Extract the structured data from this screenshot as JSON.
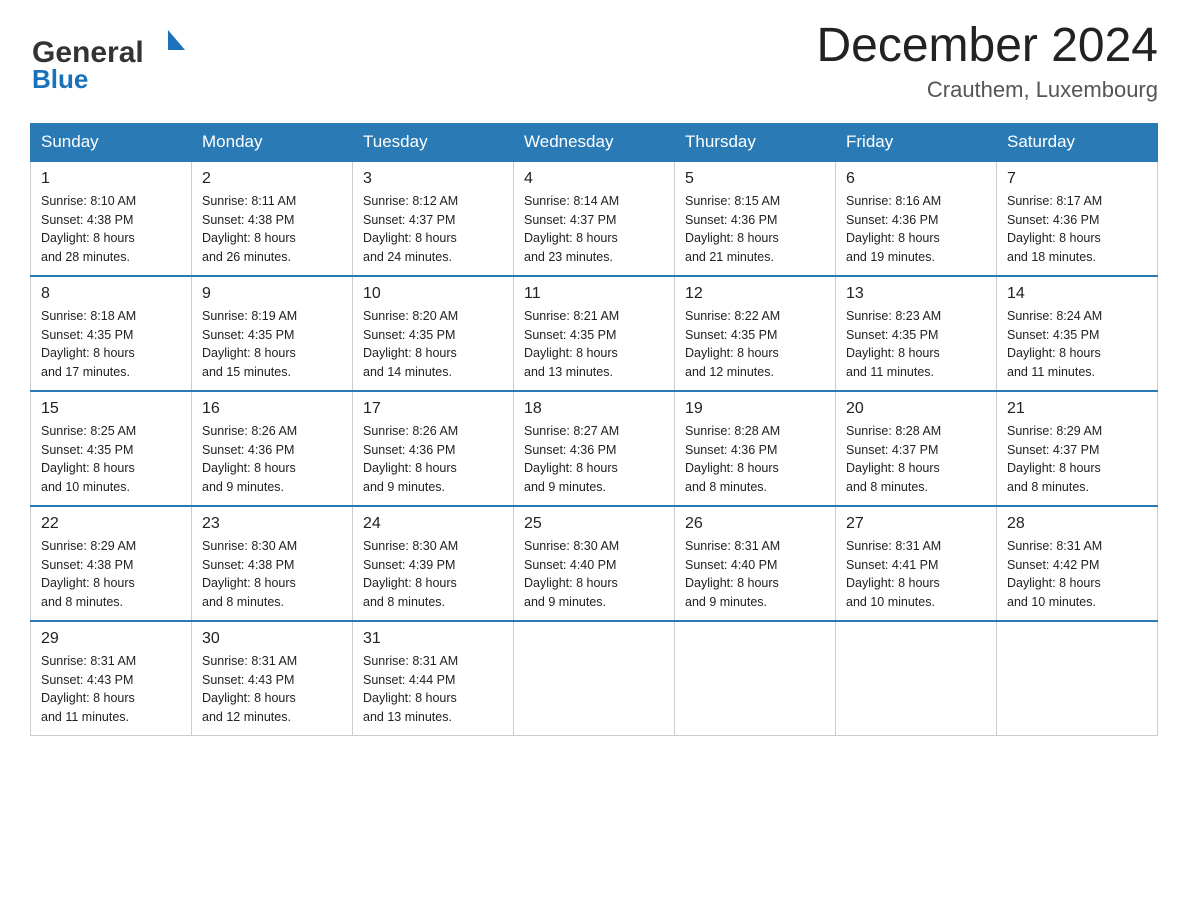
{
  "header": {
    "logo_general": "General",
    "logo_blue": "Blue",
    "title": "December 2024",
    "subtitle": "Crauthem, Luxembourg"
  },
  "days_of_week": [
    "Sunday",
    "Monday",
    "Tuesday",
    "Wednesday",
    "Thursday",
    "Friday",
    "Saturday"
  ],
  "weeks": [
    [
      {
        "day": "1",
        "sunrise": "8:10 AM",
        "sunset": "4:38 PM",
        "daylight": "8 hours and 28 minutes."
      },
      {
        "day": "2",
        "sunrise": "8:11 AM",
        "sunset": "4:38 PM",
        "daylight": "8 hours and 26 minutes."
      },
      {
        "day": "3",
        "sunrise": "8:12 AM",
        "sunset": "4:37 PM",
        "daylight": "8 hours and 24 minutes."
      },
      {
        "day": "4",
        "sunrise": "8:14 AM",
        "sunset": "4:37 PM",
        "daylight": "8 hours and 23 minutes."
      },
      {
        "day": "5",
        "sunrise": "8:15 AM",
        "sunset": "4:36 PM",
        "daylight": "8 hours and 21 minutes."
      },
      {
        "day": "6",
        "sunrise": "8:16 AM",
        "sunset": "4:36 PM",
        "daylight": "8 hours and 19 minutes."
      },
      {
        "day": "7",
        "sunrise": "8:17 AM",
        "sunset": "4:36 PM",
        "daylight": "8 hours and 18 minutes."
      }
    ],
    [
      {
        "day": "8",
        "sunrise": "8:18 AM",
        "sunset": "4:35 PM",
        "daylight": "8 hours and 17 minutes."
      },
      {
        "day": "9",
        "sunrise": "8:19 AM",
        "sunset": "4:35 PM",
        "daylight": "8 hours and 15 minutes."
      },
      {
        "day": "10",
        "sunrise": "8:20 AM",
        "sunset": "4:35 PM",
        "daylight": "8 hours and 14 minutes."
      },
      {
        "day": "11",
        "sunrise": "8:21 AM",
        "sunset": "4:35 PM",
        "daylight": "8 hours and 13 minutes."
      },
      {
        "day": "12",
        "sunrise": "8:22 AM",
        "sunset": "4:35 PM",
        "daylight": "8 hours and 12 minutes."
      },
      {
        "day": "13",
        "sunrise": "8:23 AM",
        "sunset": "4:35 PM",
        "daylight": "8 hours and 11 minutes."
      },
      {
        "day": "14",
        "sunrise": "8:24 AM",
        "sunset": "4:35 PM",
        "daylight": "8 hours and 11 minutes."
      }
    ],
    [
      {
        "day": "15",
        "sunrise": "8:25 AM",
        "sunset": "4:35 PM",
        "daylight": "8 hours and 10 minutes."
      },
      {
        "day": "16",
        "sunrise": "8:26 AM",
        "sunset": "4:36 PM",
        "daylight": "8 hours and 9 minutes."
      },
      {
        "day": "17",
        "sunrise": "8:26 AM",
        "sunset": "4:36 PM",
        "daylight": "8 hours and 9 minutes."
      },
      {
        "day": "18",
        "sunrise": "8:27 AM",
        "sunset": "4:36 PM",
        "daylight": "8 hours and 9 minutes."
      },
      {
        "day": "19",
        "sunrise": "8:28 AM",
        "sunset": "4:36 PM",
        "daylight": "8 hours and 8 minutes."
      },
      {
        "day": "20",
        "sunrise": "8:28 AM",
        "sunset": "4:37 PM",
        "daylight": "8 hours and 8 minutes."
      },
      {
        "day": "21",
        "sunrise": "8:29 AM",
        "sunset": "4:37 PM",
        "daylight": "8 hours and 8 minutes."
      }
    ],
    [
      {
        "day": "22",
        "sunrise": "8:29 AM",
        "sunset": "4:38 PM",
        "daylight": "8 hours and 8 minutes."
      },
      {
        "day": "23",
        "sunrise": "8:30 AM",
        "sunset": "4:38 PM",
        "daylight": "8 hours and 8 minutes."
      },
      {
        "day": "24",
        "sunrise": "8:30 AM",
        "sunset": "4:39 PM",
        "daylight": "8 hours and 8 minutes."
      },
      {
        "day": "25",
        "sunrise": "8:30 AM",
        "sunset": "4:40 PM",
        "daylight": "8 hours and 9 minutes."
      },
      {
        "day": "26",
        "sunrise": "8:31 AM",
        "sunset": "4:40 PM",
        "daylight": "8 hours and 9 minutes."
      },
      {
        "day": "27",
        "sunrise": "8:31 AM",
        "sunset": "4:41 PM",
        "daylight": "8 hours and 10 minutes."
      },
      {
        "day": "28",
        "sunrise": "8:31 AM",
        "sunset": "4:42 PM",
        "daylight": "8 hours and 10 minutes."
      }
    ],
    [
      {
        "day": "29",
        "sunrise": "8:31 AM",
        "sunset": "4:43 PM",
        "daylight": "8 hours and 11 minutes."
      },
      {
        "day": "30",
        "sunrise": "8:31 AM",
        "sunset": "4:43 PM",
        "daylight": "8 hours and 12 minutes."
      },
      {
        "day": "31",
        "sunrise": "8:31 AM",
        "sunset": "4:44 PM",
        "daylight": "8 hours and 13 minutes."
      },
      null,
      null,
      null,
      null
    ]
  ]
}
